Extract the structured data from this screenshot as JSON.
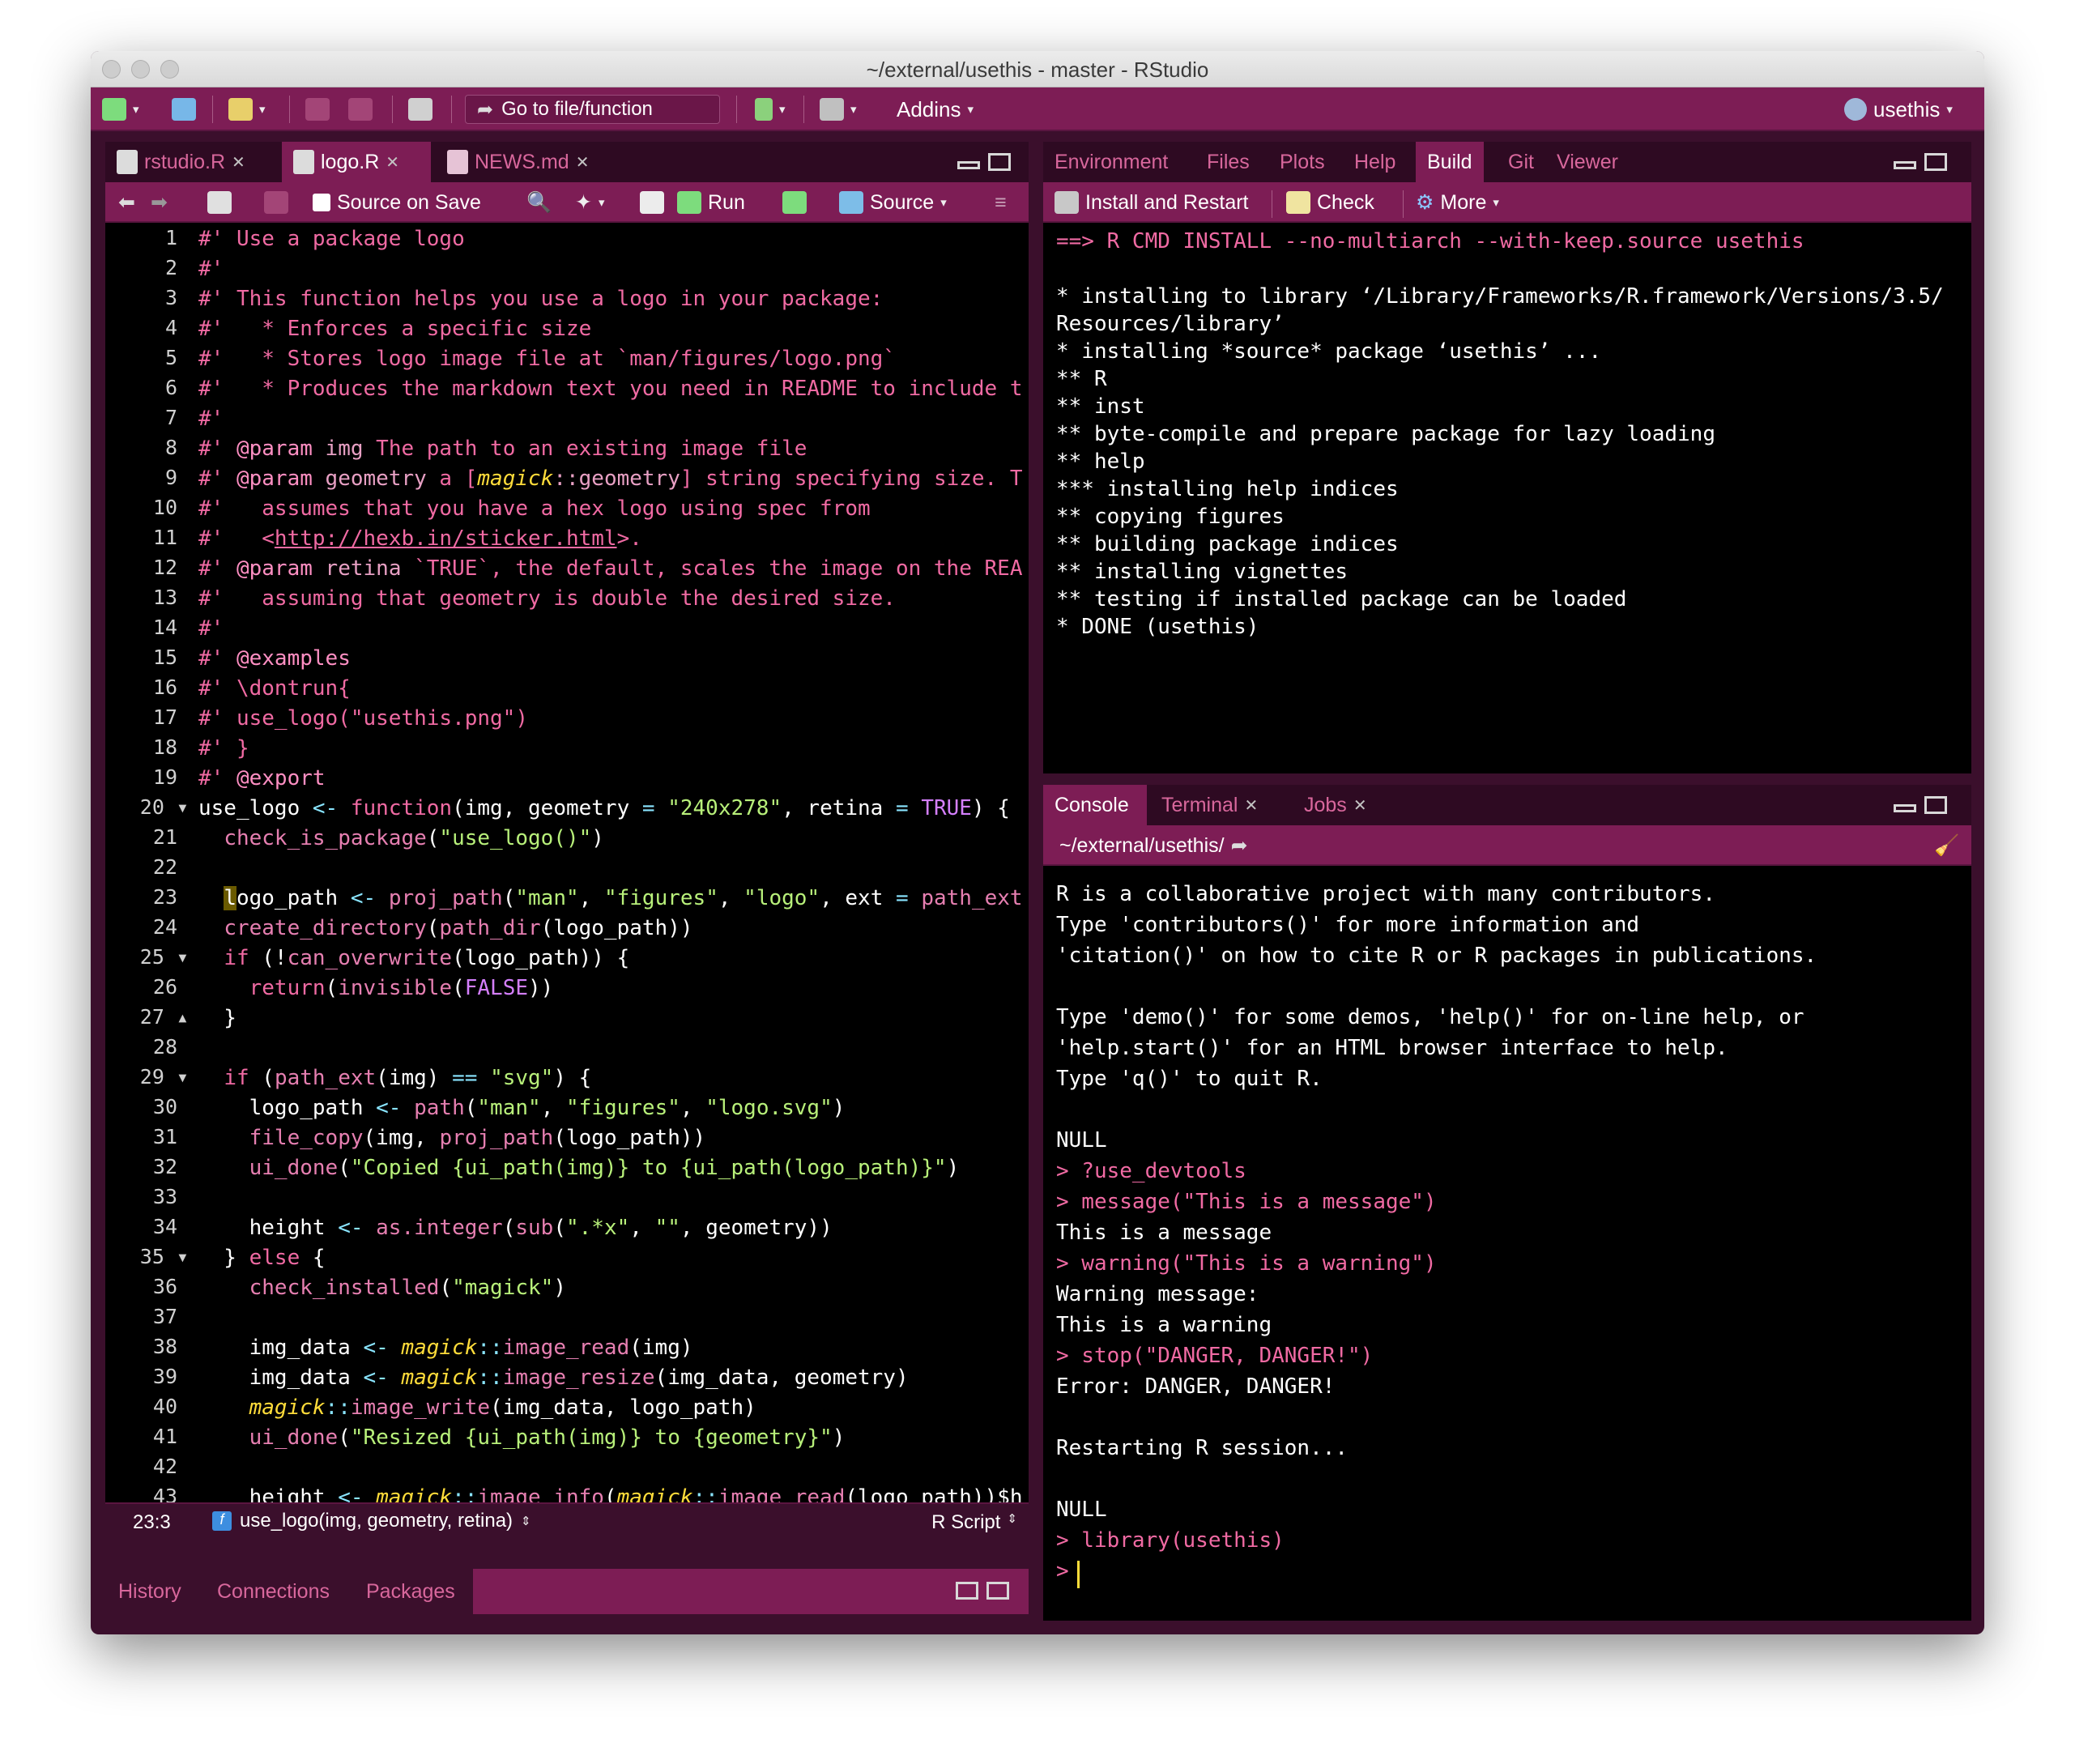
{
  "window": {
    "title": "~/external/usethis - master - RStudio"
  },
  "main_toolbar": {
    "goto_placeholder": "Go to file/function",
    "addins_label": "Addins",
    "project_label": "usethis"
  },
  "editor": {
    "tabs": [
      {
        "label": "rstudio.R"
      },
      {
        "label": "logo.R"
      },
      {
        "label": "NEWS.md"
      }
    ],
    "toolbar": {
      "source_on_save": "Source on Save",
      "run": "Run",
      "source": "Source"
    },
    "status": {
      "position": "23:3",
      "function": "use_logo(img, geometry, retina)",
      "filetype": "R Script"
    }
  },
  "top_right": {
    "tabs": [
      "Environment",
      "Files",
      "Plots",
      "Help",
      "Build",
      "Git",
      "Viewer"
    ],
    "toolbar": {
      "install": "Install and Restart",
      "check": "Check",
      "more": "More"
    },
    "output": [
      "==> R CMD INSTALL --no-multiarch --with-keep.source usethis",
      "",
      "* installing to library ‘/Library/Frameworks/R.framework/Versions/3.5/",
      "Resources/library’",
      "* installing *source* package ‘usethis’ ...",
      "** R",
      "** inst",
      "** byte-compile and prepare package for lazy loading",
      "** help",
      "*** installing help indices",
      "** copying figures",
      "** building package indices",
      "** installing vignettes",
      "** testing if installed package can be loaded",
      "* DONE (usethis)"
    ]
  },
  "console": {
    "tabs": [
      "Console",
      "Terminal",
      "Jobs"
    ],
    "path": "~/external/usethis/",
    "lines": [
      {
        "t": "R is a collaborative project with many contributors.",
        "k": "o"
      },
      {
        "t": "Type 'contributors()' for more information and",
        "k": "o"
      },
      {
        "t": "'citation()' on how to cite R or R packages in publications.",
        "k": "o"
      },
      {
        "t": "",
        "k": "o"
      },
      {
        "t": "Type 'demo()' for some demos, 'help()' for on-line help, or",
        "k": "o"
      },
      {
        "t": "'help.start()' for an HTML browser interface to help.",
        "k": "o"
      },
      {
        "t": "Type 'q()' to quit R.",
        "k": "o"
      },
      {
        "t": "",
        "k": "o"
      },
      {
        "t": "NULL",
        "k": "o"
      },
      {
        "t": "> ?use_devtools",
        "k": "i"
      },
      {
        "t": "> message(\"This is a message\")",
        "k": "i"
      },
      {
        "t": "This is a message",
        "k": "o"
      },
      {
        "t": "> warning(\"This is a warning\")",
        "k": "i"
      },
      {
        "t": "Warning message:",
        "k": "o"
      },
      {
        "t": "This is a warning",
        "k": "o"
      },
      {
        "t": "> stop(\"DANGER, DANGER!\")",
        "k": "i"
      },
      {
        "t": "Error: DANGER, DANGER!",
        "k": "o"
      },
      {
        "t": "",
        "k": "o"
      },
      {
        "t": "Restarting R session...",
        "k": "o"
      },
      {
        "t": "",
        "k": "o"
      },
      {
        "t": "NULL",
        "k": "o"
      },
      {
        "t": "> library(usethis)",
        "k": "i"
      },
      {
        "t": ">",
        "k": "i"
      }
    ]
  },
  "bottom_left": {
    "tabs": [
      "History",
      "Connections",
      "Packages"
    ]
  },
  "colors": {
    "accent": "#7d1d55",
    "pink": "#f06aa3",
    "string": "#b8f07a",
    "package": "#ffdc3a"
  }
}
